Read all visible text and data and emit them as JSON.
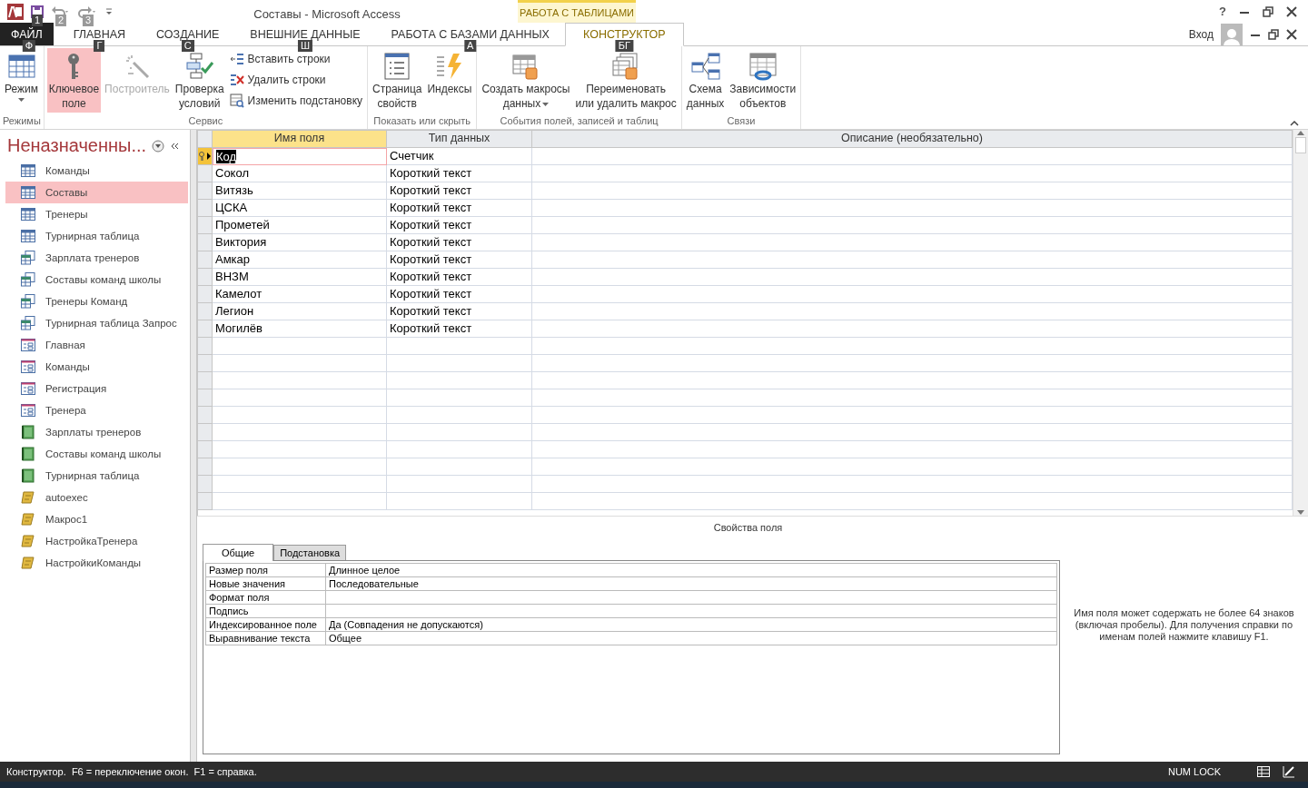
{
  "window": {
    "title": "Составы - Microsoft Access",
    "contextual_group": "РАБОТА С ТАБЛИЦАМИ",
    "help": "?",
    "account": "Вход"
  },
  "quick_access": [
    {
      "kind": "save",
      "keytip": "1"
    },
    {
      "kind": "undo",
      "keytip": "2"
    },
    {
      "kind": "redo",
      "keytip": "3"
    }
  ],
  "tabs": [
    {
      "label": "ФАЙЛ",
      "kind": "file",
      "selected": false,
      "keytip": "Ф"
    },
    {
      "label": "ГЛАВНАЯ",
      "kind": "tab",
      "selected": false,
      "keytip": "Г"
    },
    {
      "label": "СОЗДАНИЕ",
      "kind": "tab",
      "selected": false,
      "keytip": "С"
    },
    {
      "label": "ВНЕШНИЕ ДАННЫЕ",
      "kind": "tab",
      "selected": false,
      "keytip": "Ш"
    },
    {
      "label": "РАБОТА С БАЗАМИ ДАННЫХ",
      "kind": "tab",
      "selected": false,
      "keytip": "А"
    },
    {
      "label": "КОНСТРУКТОР",
      "kind": "contextual",
      "selected": true,
      "keytip": "БГ"
    }
  ],
  "ribbon": [
    {
      "label": "Режимы",
      "items": [
        {
          "kind": "large",
          "lines": [
            "Режим"
          ],
          "dropdown": true,
          "pressed": false,
          "disabled": false
        }
      ]
    },
    {
      "label": "Сервис",
      "items": [
        {
          "kind": "large",
          "lines": [
            "Ключевое",
            "поле"
          ],
          "dropdown": false,
          "pressed": true,
          "disabled": false
        },
        {
          "kind": "large",
          "lines": [
            "Построитель"
          ],
          "dropdown": false,
          "pressed": false,
          "disabled": true
        },
        {
          "kind": "large",
          "lines": [
            "Проверка",
            "условий"
          ],
          "dropdown": false,
          "pressed": false,
          "disabled": false
        },
        {
          "kind": "small",
          "items": [
            {
              "label": "Вставить строки"
            },
            {
              "label": "Удалить строки"
            },
            {
              "label": "Изменить подстановку"
            }
          ]
        }
      ]
    },
    {
      "label": "Показать или скрыть",
      "items": [
        {
          "kind": "large",
          "lines": [
            "Страница",
            "свойств"
          ],
          "dropdown": false,
          "pressed": false,
          "disabled": false
        },
        {
          "kind": "large",
          "lines": [
            "Индексы"
          ],
          "dropdown": false,
          "pressed": false,
          "disabled": false
        }
      ]
    },
    {
      "label": "События полей, записей и таблиц",
      "items": [
        {
          "kind": "large",
          "lines": [
            "Создать макросы",
            "данных"
          ],
          "dropdown": true,
          "pressed": false,
          "disabled": false
        },
        {
          "kind": "large",
          "lines": [
            "Переименовать",
            "или удалить макрос"
          ],
          "dropdown": false,
          "pressed": false,
          "disabled": false
        }
      ]
    },
    {
      "label": "Связи",
      "items": [
        {
          "kind": "large",
          "lines": [
            "Схема",
            "данных"
          ],
          "dropdown": false,
          "pressed": false,
          "disabled": false
        },
        {
          "kind": "large",
          "lines": [
            "Зависимости",
            "объектов"
          ],
          "dropdown": false,
          "pressed": false,
          "disabled": false
        }
      ]
    }
  ],
  "nav": {
    "title": "Неназначенны...",
    "items": [
      {
        "label": "Команды",
        "kind": "table",
        "selected": false
      },
      {
        "label": "Составы",
        "kind": "table",
        "selected": true
      },
      {
        "label": "Тренеры",
        "kind": "table",
        "selected": false
      },
      {
        "label": "Турнирная таблица",
        "kind": "table",
        "selected": false
      },
      {
        "label": "Зарплата тренеров",
        "kind": "query",
        "selected": false
      },
      {
        "label": "Составы команд школы",
        "kind": "query",
        "selected": false
      },
      {
        "label": "Тренеры Команд",
        "kind": "query",
        "selected": false
      },
      {
        "label": "Турнирная таблица Запрос",
        "kind": "query",
        "selected": false
      },
      {
        "label": "Главная",
        "kind": "form",
        "selected": false
      },
      {
        "label": "Команды",
        "kind": "form",
        "selected": false
      },
      {
        "label": "Регистрация",
        "kind": "form",
        "selected": false
      },
      {
        "label": "Тренера",
        "kind": "form",
        "selected": false
      },
      {
        "label": "Зарплаты тренеров",
        "kind": "report",
        "selected": false
      },
      {
        "label": "Составы команд школы",
        "kind": "report",
        "selected": false
      },
      {
        "label": "Турнирная таблица",
        "kind": "report",
        "selected": false
      },
      {
        "label": "autoexec",
        "kind": "macro",
        "selected": false
      },
      {
        "label": "Макрос1",
        "kind": "macro",
        "selected": false
      },
      {
        "label": "НастройкаТренера",
        "kind": "macro",
        "selected": false
      },
      {
        "label": "НастройкиКоманды",
        "kind": "macro",
        "selected": false
      }
    ]
  },
  "design_grid": {
    "columns": [
      {
        "label": "Имя поля",
        "selected": true
      },
      {
        "label": "Тип данных",
        "selected": false
      },
      {
        "label": "Описание (необязательно)",
        "selected": false
      }
    ],
    "rows": [
      {
        "name": "Код",
        "type": "Счетчик",
        "primary_key": true,
        "selected": true
      },
      {
        "name": "Сокол",
        "type": "Короткий текст",
        "primary_key": false,
        "selected": false
      },
      {
        "name": "Витязь",
        "type": "Короткий текст",
        "primary_key": false,
        "selected": false
      },
      {
        "name": "ЦСКА",
        "type": "Короткий текст",
        "primary_key": false,
        "selected": false
      },
      {
        "name": "Прометей",
        "type": "Короткий текст",
        "primary_key": false,
        "selected": false
      },
      {
        "name": "Виктория",
        "type": "Короткий текст",
        "primary_key": false,
        "selected": false
      },
      {
        "name": "Амкар",
        "type": "Короткий текст",
        "primary_key": false,
        "selected": false
      },
      {
        "name": "ВНЗМ",
        "type": "Короткий текст",
        "primary_key": false,
        "selected": false
      },
      {
        "name": "Камелот",
        "type": "Короткий текст",
        "primary_key": false,
        "selected": false
      },
      {
        "name": "Легион",
        "type": "Короткий текст",
        "primary_key": false,
        "selected": false
      },
      {
        "name": "Могилёв",
        "type": "Короткий текст",
        "primary_key": false,
        "selected": false
      }
    ]
  },
  "field_properties": {
    "title": "Свойства поля",
    "tabs": [
      {
        "label": "Общие",
        "selected": true
      },
      {
        "label": "Подстановка",
        "selected": false
      }
    ],
    "rows": [
      {
        "label": "Размер поля",
        "value": "Длинное целое"
      },
      {
        "label": "Новые значения",
        "value": "Последовательные"
      },
      {
        "label": "Формат поля"
      },
      {
        "label": "Подпись"
      },
      {
        "label": "Индексированное поле",
        "value": "Да (Совпадения не допускаются)"
      },
      {
        "label": "Выравнивание текста",
        "value": "Общее"
      }
    ],
    "help": "Имя поля может содержать не более 64 знаков (включая пробелы). Для получения справки по именам полей нажмите клавишу F1."
  },
  "status_bar": {
    "text": "Конструктор.  F6 = переключение окон.  F1 = справка.",
    "indicator": "NUM LOCK"
  }
}
